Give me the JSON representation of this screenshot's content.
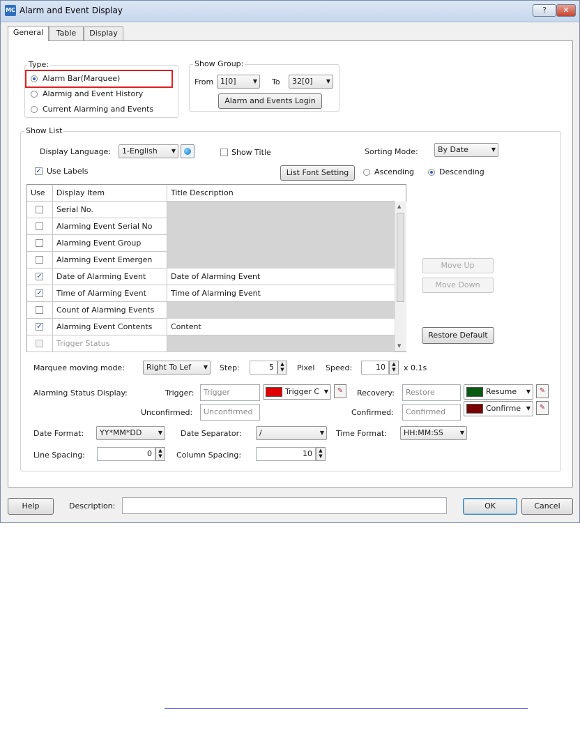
{
  "window": {
    "title": "Alarm and Event Display",
    "app_icon": "MC",
    "help_symbol": "?",
    "close_symbol": "✕"
  },
  "tabs": [
    {
      "label": "General",
      "active": true
    },
    {
      "label": "Table",
      "active": false
    },
    {
      "label": "Display",
      "active": false
    }
  ],
  "type_group": {
    "label": "Type:",
    "options": [
      {
        "label": "Alarm Bar(Marquee)",
        "selected": true
      },
      {
        "label": "Alarmig and Event History",
        "selected": false
      },
      {
        "label": "Current Alarming and Events",
        "selected": false
      }
    ]
  },
  "show_group": {
    "label": "Show Group:",
    "from_label": "From",
    "from_value": "1[0]",
    "to_label": "To",
    "to_value": "32[0]",
    "login_button": "Alarm and Events Login"
  },
  "show_list": {
    "label": "Show List",
    "display_language_label": "Display Language:",
    "display_language_value": "1-English",
    "show_title_label": "Show Title",
    "show_title_checked": false,
    "sorting_mode_label": "Sorting Mode:",
    "sorting_mode_value": "By Date",
    "use_labels_label": "Use Labels",
    "use_labels_checked": true,
    "list_font_button": "List Font Setting",
    "ascending_label": "Ascending",
    "descending_label": "Descending",
    "order_selected": "Descending"
  },
  "table": {
    "headers": [
      "Use",
      "Display Item",
      "Title Description"
    ],
    "rows": [
      {
        "checked": false,
        "item": "Serial No.",
        "title": "",
        "enabled": false
      },
      {
        "checked": false,
        "item": "Alarming Event Serial No",
        "title": "",
        "enabled": false
      },
      {
        "checked": false,
        "item": "Alarming Event Group",
        "title": "",
        "enabled": false
      },
      {
        "checked": false,
        "item": "Alarming Event Emergen",
        "title": "",
        "enabled": false
      },
      {
        "checked": true,
        "item": "Date of Alarming Event",
        "title": "Date of Alarming Event",
        "enabled": true
      },
      {
        "checked": true,
        "item": "Time of Alarming Event",
        "title": "Time of Alarming Event",
        "enabled": true
      },
      {
        "checked": false,
        "item": "Count of Alarming Events",
        "title": "",
        "enabled": false
      },
      {
        "checked": true,
        "item": "Alarming Event Contents",
        "title": "Content",
        "enabled": true
      },
      {
        "checked": false,
        "item": "Trigger Status",
        "title": "",
        "enabled": false,
        "dim": true
      }
    ]
  },
  "side_buttons": {
    "move_up": "Move Up",
    "move_down": "Move Down",
    "restore_default": "Restore Default"
  },
  "marquee": {
    "mode_label": "Marquee moving mode:",
    "mode_value": "Right To Lef",
    "step_label": "Step:",
    "step_value": "5",
    "step_unit": "Pixel",
    "speed_label": "Speed:",
    "speed_value": "10",
    "speed_unit": "x 0.1s"
  },
  "alarm_status": {
    "label": "Alarming Status Display:",
    "trigger_label": "Trigger:",
    "trigger_value": "Trigger",
    "trigger_color": "#e00000",
    "trigger_color_name": "Trigger C",
    "recovery_label": "Recovery:",
    "recovery_value": "Restore",
    "recovery_color": "#0a5a14",
    "recovery_color_name": "Resume",
    "unconfirmed_label": "Unconfirmed:",
    "unconfirmed_value": "Unconfirmed",
    "confirmed_label": "Confirmed:",
    "confirmed_value": "Confirmed",
    "confirmed_color": "#7a0000",
    "confirmed_color_name": "Confirme"
  },
  "formats": {
    "date_format_label": "Date Format:",
    "date_format_value": "YY*MM*DD",
    "date_separator_label": "Date Separator:",
    "date_separator_value": "/",
    "time_format_label": "Time Format:",
    "time_format_value": "HH:MM:SS",
    "line_spacing_label": "Line Spacing:",
    "line_spacing_value": "0",
    "column_spacing_label": "Column Spacing:",
    "column_spacing_value": "10"
  },
  "footer": {
    "help_button": "Help",
    "description_label": "Description:",
    "description_value": "",
    "ok_button": "OK",
    "cancel_button": "Cancel"
  },
  "colors": {
    "highlight_box": "#e02020",
    "link_line": "#3b3bd6"
  }
}
